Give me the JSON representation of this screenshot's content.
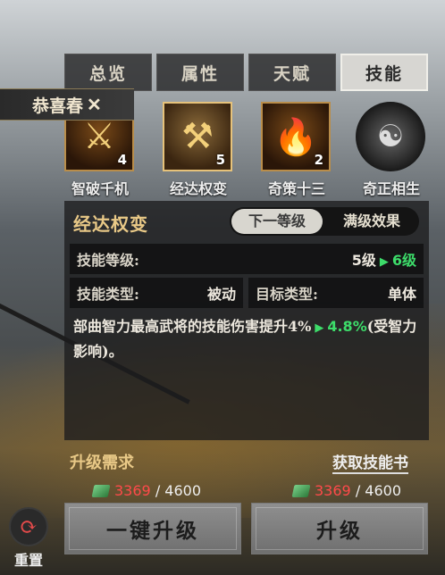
{
  "tabs": [
    {
      "label": "总览"
    },
    {
      "label": "属性"
    },
    {
      "label": "天赋"
    },
    {
      "label": "技能"
    }
  ],
  "banner": {
    "text": "恭喜春",
    "close": "✕"
  },
  "skills": [
    {
      "name": "智破千机",
      "level": "4",
      "icon": "sword-icon"
    },
    {
      "name": "经达权变",
      "level": "5",
      "icon": "crossed-axes-icon"
    },
    {
      "name": "奇策十三",
      "level": "2",
      "icon": "flame-scroll-icon"
    },
    {
      "name": "奇正相生",
      "level": "",
      "icon": "ink-swirl-icon"
    }
  ],
  "panel": {
    "title": "经达权变",
    "seg": {
      "next": "下一等级",
      "max": "满级效果"
    },
    "level_label": "技能等级:",
    "level_from": "5级",
    "level_to": "6级",
    "type_label": "技能类型:",
    "type_value": "被动",
    "target_label": "目标类型:",
    "target_value": "单体",
    "desc_main": "部曲智力最高武将的技能伤害提升4%",
    "desc_new": "4.8%",
    "desc_tail": "(受智力影响)。"
  },
  "requirements": {
    "label": "升级需求",
    "get_book": "获取技能书"
  },
  "costs": [
    {
      "have": "3369",
      "need": "/ 4600"
    },
    {
      "have": "3369",
      "need": "/ 4600"
    }
  ],
  "buttons": {
    "one_key": "一键升级",
    "upgrade": "升级",
    "reset": "重置"
  },
  "colors": {
    "accent_gold": "#e9c987",
    "green": "#3ddc6a",
    "red": "#ff4a4a"
  }
}
